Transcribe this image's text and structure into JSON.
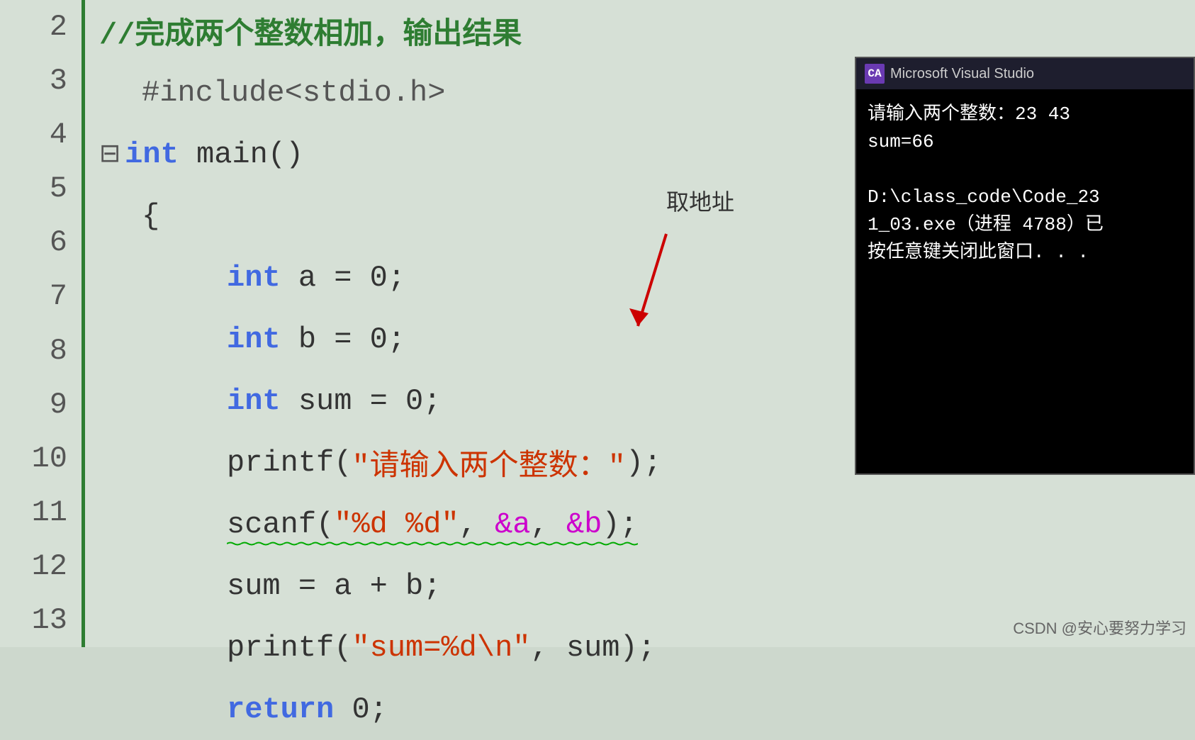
{
  "lineNumbers": [
    "2",
    "3",
    "4",
    "5",
    "6",
    "7",
    "8",
    "9",
    "10",
    "11",
    "12",
    "13"
  ],
  "codeLines": [
    {
      "id": "line2",
      "content": "comment",
      "text": "//完成两个整数相加，输出结果"
    },
    {
      "id": "line3",
      "content": "preprocessor",
      "text": "#include<stdio.h>"
    },
    {
      "id": "line4",
      "content": "main_decl",
      "text": "int main()"
    },
    {
      "id": "line5",
      "content": "brace_open",
      "text": "{"
    },
    {
      "id": "line6",
      "content": "int_a",
      "text": "int a = 0;"
    },
    {
      "id": "line7",
      "content": "int_b",
      "text": "int b = 0;"
    },
    {
      "id": "line8",
      "content": "int_sum",
      "text": "int sum = 0;"
    },
    {
      "id": "line9",
      "content": "printf1",
      "text": "printf(\"请输入两个整数：\");"
    },
    {
      "id": "line10",
      "content": "scanf",
      "text": "scanf(\"%d %d\", &a, &b);"
    },
    {
      "id": "line11",
      "content": "sum_calc",
      "text": "sum = a + b;"
    },
    {
      "id": "line12",
      "content": "printf2",
      "text": "printf(\"sum=%d\\n\", sum);"
    },
    {
      "id": "line13",
      "content": "return",
      "text": "return 0;"
    }
  ],
  "annotation": {
    "text": "取地址",
    "label": "address-of annotation"
  },
  "vsWindow": {
    "title": "Microsoft Visual Studio",
    "logoText": "CA",
    "lines": [
      "请输入两个整数：23 43",
      "sum=66",
      "",
      "D:\\class_code\\Code_23",
      "1_03.exe（进程 4788）已",
      "按任意键关闭此窗口. . ."
    ]
  },
  "watermark": "CSDN @安心要努力学习",
  "colors": {
    "background": "#d6e0d6",
    "leftBorder": "#2e7d32",
    "comment": "#2e7d32",
    "keyword": "#4169e1",
    "string": "#cc3300",
    "wavy": "#00aa00",
    "annotation": "#cc0000",
    "vsBackground": "#000000",
    "vsTitlebar": "#1e1e2e"
  }
}
